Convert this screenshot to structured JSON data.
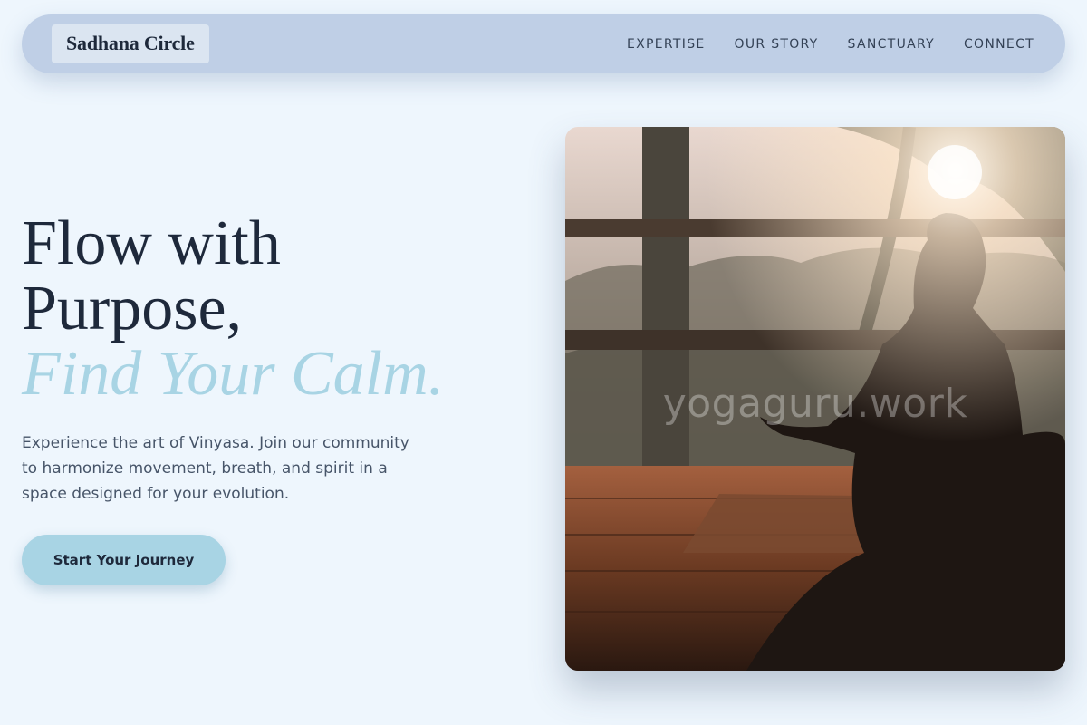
{
  "brand": {
    "name": "Sadhana Circle"
  },
  "nav": {
    "links": [
      {
        "label": "EXPERTISE"
      },
      {
        "label": "OUR STORY"
      },
      {
        "label": "SANCTUARY"
      },
      {
        "label": "CONNECT"
      }
    ]
  },
  "hero": {
    "title_line1": "Flow with",
    "title_line2": "Purpose,",
    "title_accent": "Find Your Calm.",
    "description": "Experience the art of Vinyasa. Join our community to harmonize movement, breath, and spirit in a space designed for your evolution.",
    "cta_label": "Start Your Journey"
  },
  "image": {
    "watermark": "yogaguru.work"
  },
  "colors": {
    "background": "#eef6fd",
    "navbar": "#bfcfe6",
    "accent": "#a8d4e4",
    "text_dark": "#1e293b"
  }
}
